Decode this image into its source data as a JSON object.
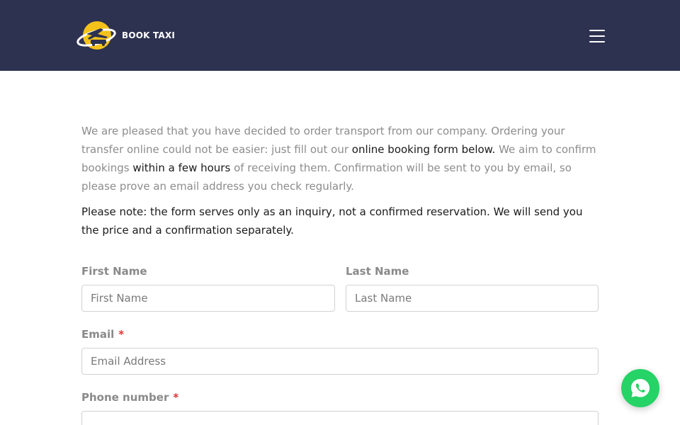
{
  "header": {
    "brand": "BOOK TAXI",
    "menu_icon": "hamburger-menu-icon"
  },
  "intro": {
    "part1": "We are pleased that you have decided to order transport  from our company. Ordering your transfer online could not be easier: just fill out our ",
    "link1": "online booking form below.",
    "part2": " We aim to confirm bookings ",
    "link2": "within a few hours",
    "part3": " of receiving them. Confirmation will be sent to you by email, so please prove an email address you check regularly."
  },
  "note": "Please note: the form serves only as an inquiry, not a confirmed reservation. We will send you the price and a confirmation separately.",
  "form": {
    "first_name": {
      "label": "First Name",
      "placeholder": "First Name",
      "value": ""
    },
    "last_name": {
      "label": "Last Name",
      "placeholder": "Last Name",
      "value": ""
    },
    "email": {
      "label": "Email",
      "required_mark": "*",
      "placeholder": "Email Address",
      "value": ""
    },
    "phone": {
      "label": "Phone number",
      "required_mark": "*",
      "placeholder": "",
      "value": ""
    }
  },
  "whatsapp": {
    "icon": "whatsapp-icon"
  },
  "colors": {
    "header_bg": "#2d3250",
    "logo_yellow": "#f4c21b",
    "required": "#e03434",
    "whatsapp": "#25d366"
  }
}
